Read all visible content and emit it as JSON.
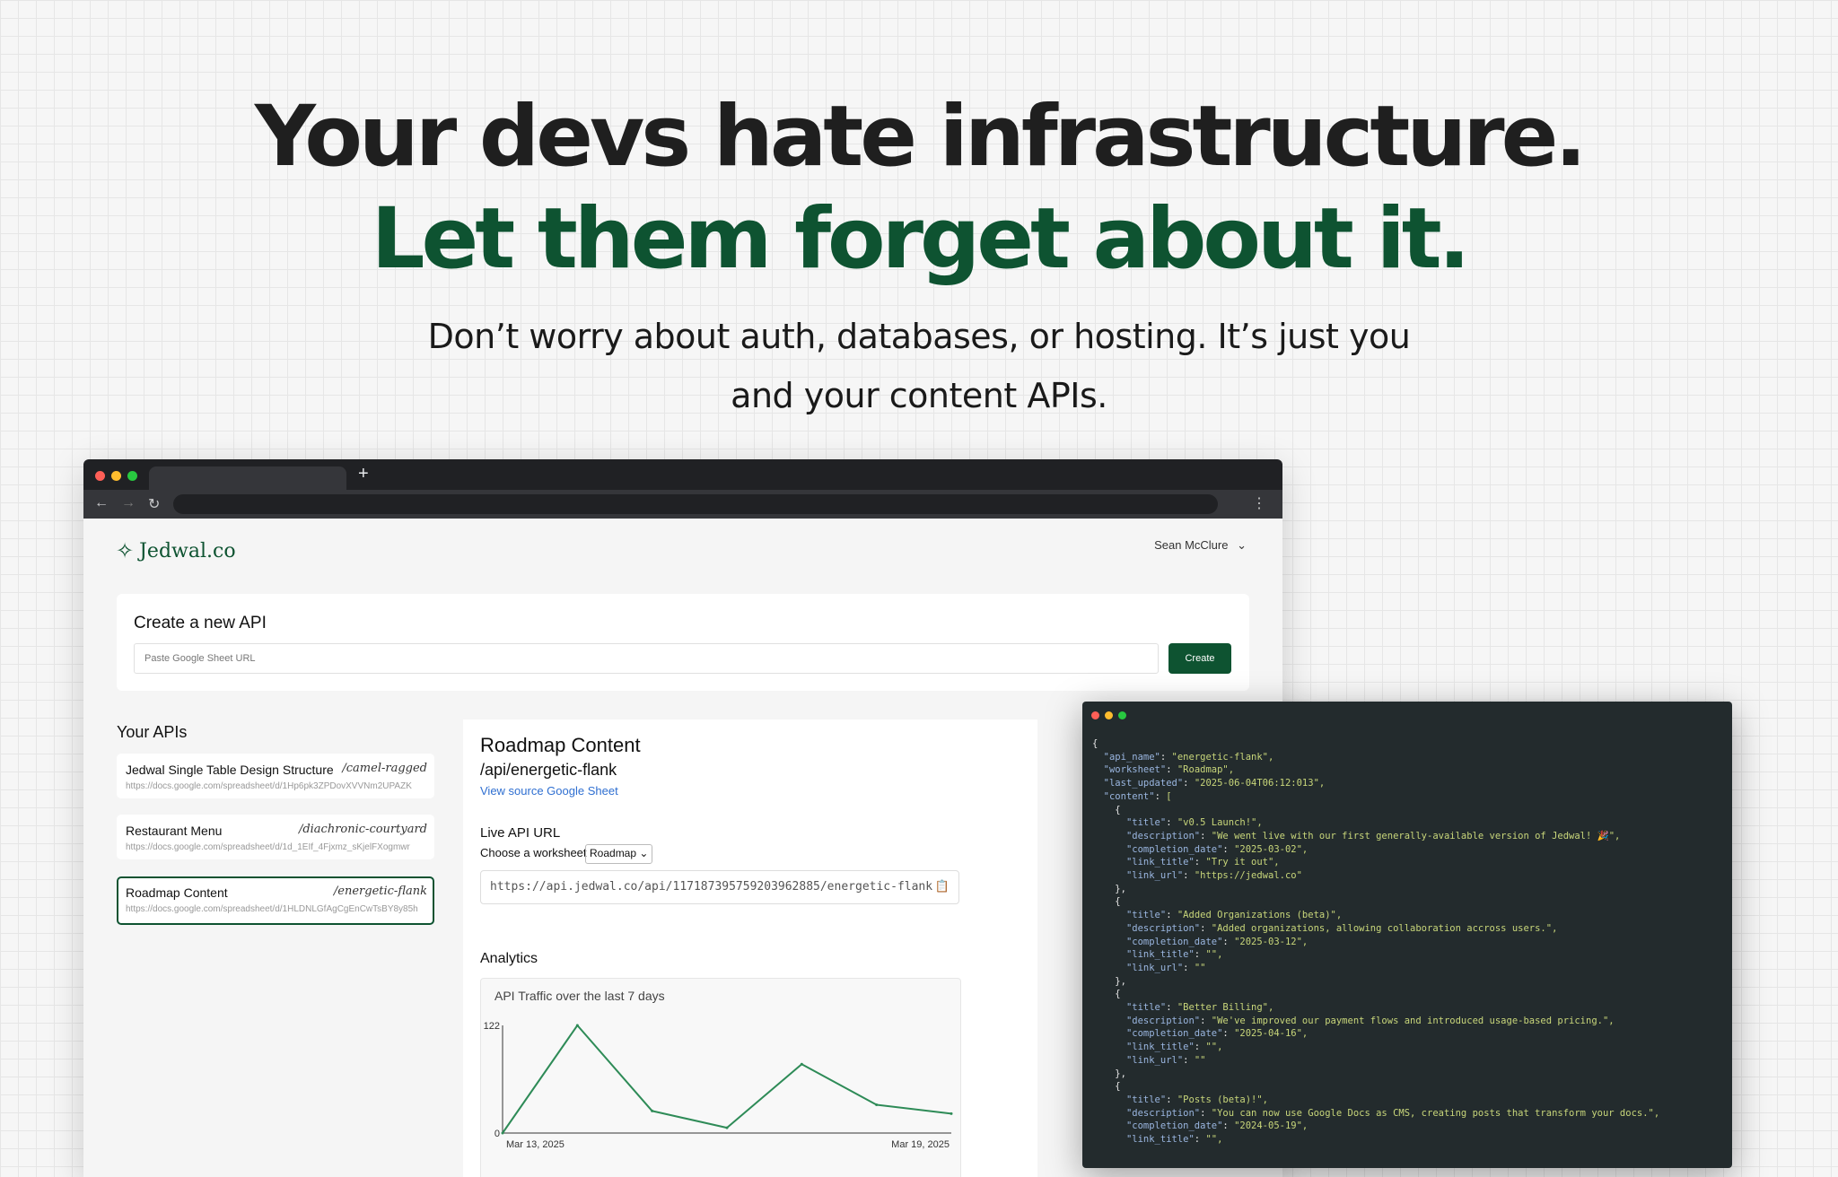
{
  "hero": {
    "line1": "Your devs hate infrastructure.",
    "line2": "Let them forget about it.",
    "sub": "Don’t worry about auth, databases, or hosting. It’s just you and your content APIs."
  },
  "browser": {
    "new_tab": "+"
  },
  "app": {
    "logo": "Jedwal.co",
    "user": "Sean McClure",
    "create": {
      "title": "Create a new API",
      "placeholder": "Paste Google Sheet URL",
      "button": "Create"
    },
    "apis_title": "Your APIs",
    "apis": [
      {
        "name": "Jedwal Single Table Design Structure",
        "slug": "/camel-ragged",
        "url": "https://docs.google.com/spreadsheet/d/1Hp6pk3ZPDovXVVNm2UPAZK",
        "active": false
      },
      {
        "name": "Restaurant Menu",
        "slug": "/diachronic-courtyard",
        "url": "https://docs.google.com/spreadsheet/d/1d_1EIf_4Fjxmz_sKjelFXogmwr",
        "active": false
      },
      {
        "name": "Roadmap Content",
        "slug": "/energetic-flank",
        "url": "https://docs.google.com/spreadsheet/d/1HLDNLGfAgCgEnCwTsBY8y85h",
        "active": true
      }
    ],
    "detail": {
      "title": "Roadmap Content",
      "path": "/api/energetic-flank",
      "source_link": "View source Google Sheet",
      "live_label": "Live API URL",
      "worksheet_label": "Choose a worksheet",
      "worksheet_value": "Roadmap",
      "api_url": "https://api.jedwal.co/api/117187395759203962885/energetic-flank",
      "analytics_label": "Analytics"
    }
  },
  "chart_data": {
    "type": "line",
    "title": "API Traffic over the last 7 days",
    "x": [
      "Mar 13, 2025",
      "Mar 14, 2025",
      "Mar 15, 2025",
      "Mar 16, 2025",
      "Mar 17, 2025",
      "Mar 18, 2025",
      "Mar 19, 2025"
    ],
    "values": [
      0,
      122,
      25,
      6,
      78,
      32,
      22
    ],
    "ylim": [
      0,
      122
    ],
    "y_ticks": [
      "0",
      "122"
    ],
    "x_tick_labels": [
      "Mar 13, 2025",
      "Mar 19, 2025"
    ],
    "color": "#2e8b57",
    "grid": false
  },
  "code_window": {
    "lines": [
      "{",
      "  \"api_name\": \"energetic-flank\",",
      "  \"worksheet\": \"Roadmap\",",
      "  \"last_updated\": \"2025-06-04T06:12:013\",",
      "  \"content\": [",
      "    {",
      "      \"title\": \"v0.5 Launch!\",",
      "      \"description\": \"We went live with our first generally-available version of Jedwal! 🎉\",",
      "      \"completion_date\": \"2025-03-02\",",
      "      \"link_title\": \"Try it out\",",
      "      \"link_url\": \"https://jedwal.co\"",
      "    },",
      "    {",
      "      \"title\": \"Added Organizations (beta)\",",
      "      \"description\": \"Added organizations, allowing collaboration accross users.\",",
      "      \"completion_date\": \"2025-03-12\",",
      "      \"link_title\": \"\",",
      "      \"link_url\": \"\"",
      "    },",
      "    {",
      "      \"title\": \"Better Billing\",",
      "      \"description\": \"We've improved our payment flows and introduced usage-based pricing.\",",
      "      \"completion_date\": \"2025-04-16\",",
      "      \"link_title\": \"\",",
      "      \"link_url\": \"\"",
      "    },",
      "    {",
      "      \"title\": \"Posts (beta)!\",",
      "      \"description\": \"You can now use Google Docs as CMS, creating posts that transform your docs.\",",
      "      \"completion_date\": \"2024-05-19\",",
      "      \"link_title\": \"\","
    ]
  },
  "colors": {
    "brand_green": "#0e5331",
    "link_blue": "#2f6fd1",
    "code_bg": "#232b2d"
  }
}
